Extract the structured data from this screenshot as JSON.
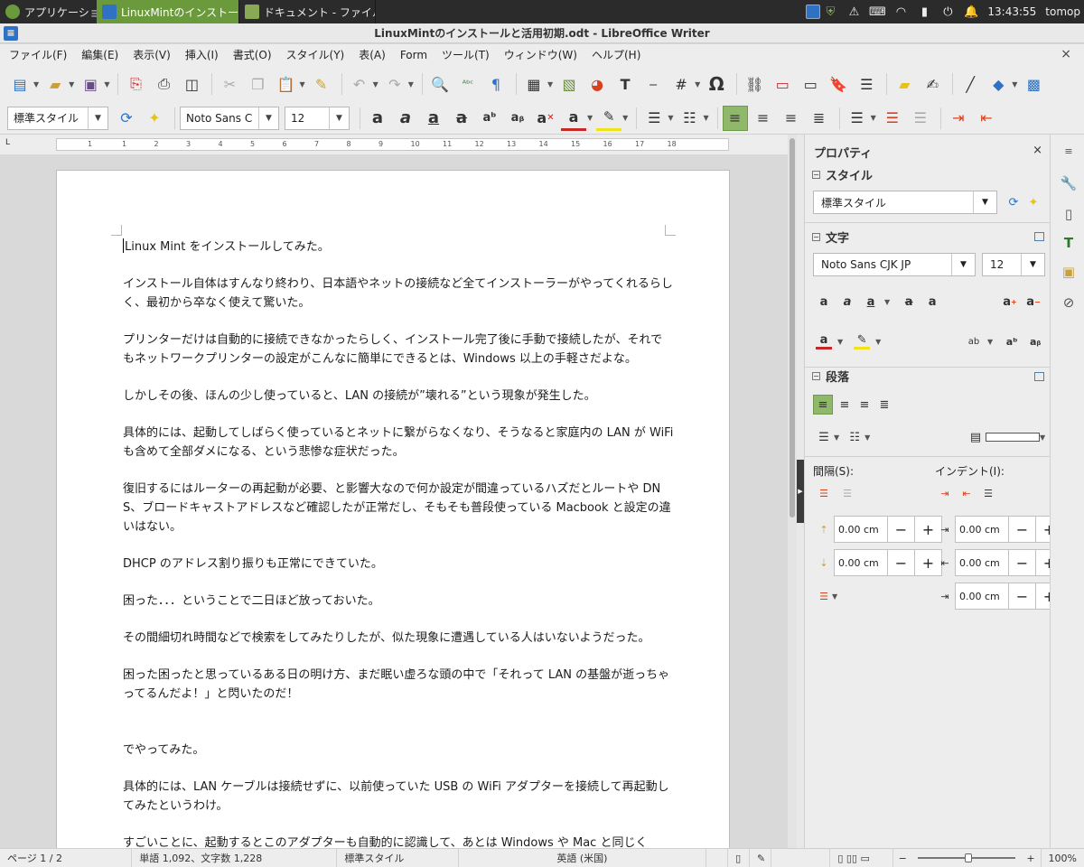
{
  "taskbar": {
    "menu_label": "アプリケーション",
    "windows": [
      {
        "label": "LinuxMintのインストール..."
      },
      {
        "label": "ドキュメント - ファイルマ..."
      }
    ],
    "clock": "13:43:55",
    "user": "tomop"
  },
  "window": {
    "title": "LinuxMintのインストールと活用初期.odt - LibreOffice Writer"
  },
  "menu": {
    "items": [
      "ファイル(F)",
      "編集(E)",
      "表示(V)",
      "挿入(I)",
      "書式(O)",
      "スタイル(Y)",
      "表(A)",
      "Form",
      "ツール(T)",
      "ウィンドウ(W)",
      "ヘルプ(H)"
    ],
    "close": "×"
  },
  "formatting": {
    "paragraph_style": "標準スタイル",
    "font_name": "Noto Sans C",
    "font_size": "12"
  },
  "ruler": {
    "corner": "L",
    "labels": [
      "1",
      "1",
      "2",
      "3",
      "4",
      "5",
      "6",
      "7",
      "8",
      "9",
      "10",
      "11",
      "12",
      "13",
      "14",
      "15",
      "16",
      "17",
      "18"
    ]
  },
  "document": {
    "paragraphs": [
      "Linux Mint をインストールしてみた。",
      "インストール自体はすんなり終わり、日本語やネットの接続など全てインストーラーがやってくれるらしく、最初から卒なく使えて驚いた。",
      "プリンターだけは自動的に接続できなかったらしく、インストール完了後に手動で接続したが、それでもネットワークプリンターの設定がこんなに簡単にできるとは、Windows 以上の手軽さだよな。",
      "しかしその後、ほんの少し使っていると、LAN の接続が”壊れる”という現象が発生した。",
      "具体的には、起動してしばらく使っているとネットに繋がらなくなり、そうなると家庭内の LAN が WiFi も含めて全部ダメになる、という悲惨な症状だった。",
      "復旧するにはルーターの再起動が必要、と影響大なので何か設定が間違っているハズだとルートや DNS、ブロードキャストアドレスなど確認したが正常だし、そもそも普段使っている Macbook と設定の違いはない。",
      "DHCP のアドレス割り振りも正常にできていた。",
      "困った．．．ということで二日ほど放っておいた。",
      "その間細切れ時間などで検索をしてみたりしたが、似た現象に遭遇している人はいないようだった。",
      "困った困ったと思っているある日の明け方、まだ眠い虚ろな頭の中で「それって LAN の基盤が逝っちゃってるんだよ！」と閃いたのだ！",
      "でやってみた。",
      "具体的には、LAN ケーブルは接続せずに、以前使っていた USB の WiFi アダプターを接続して再起動してみたというわけ。",
      "すごいことに、起動するとこのアダプターも自動的に認識して、あとは Windows や Mac と同じく"
    ]
  },
  "sidebar": {
    "title": "プロパティ",
    "close": "×",
    "style_section": "スタイル",
    "style_value": "標準スタイル",
    "char_section": "文字",
    "font_name": "Noto Sans CJK JP",
    "font_size": "12",
    "para_section": "段落",
    "spacing_label": "間隔(S):",
    "indent_label": "インデント(I):",
    "spacing_above": "0.00 cm",
    "spacing_below": "0.00 cm",
    "indent_before": "0.00 cm",
    "indent_after": "0.00 cm",
    "indent_first": "0.00 cm"
  },
  "status": {
    "page": "ページ 1 / 2",
    "words": "単語 1,092、文字数 1,228",
    "style": "標準スタイル",
    "language": "英語 (米国)",
    "zoom": "100%"
  },
  "colors": {
    "taskbar_bg": "#2b2b2b",
    "taskbar_active": "#6a9a3b",
    "toolbar_bg": "#ededed",
    "accent_active": "#8fb86a"
  }
}
